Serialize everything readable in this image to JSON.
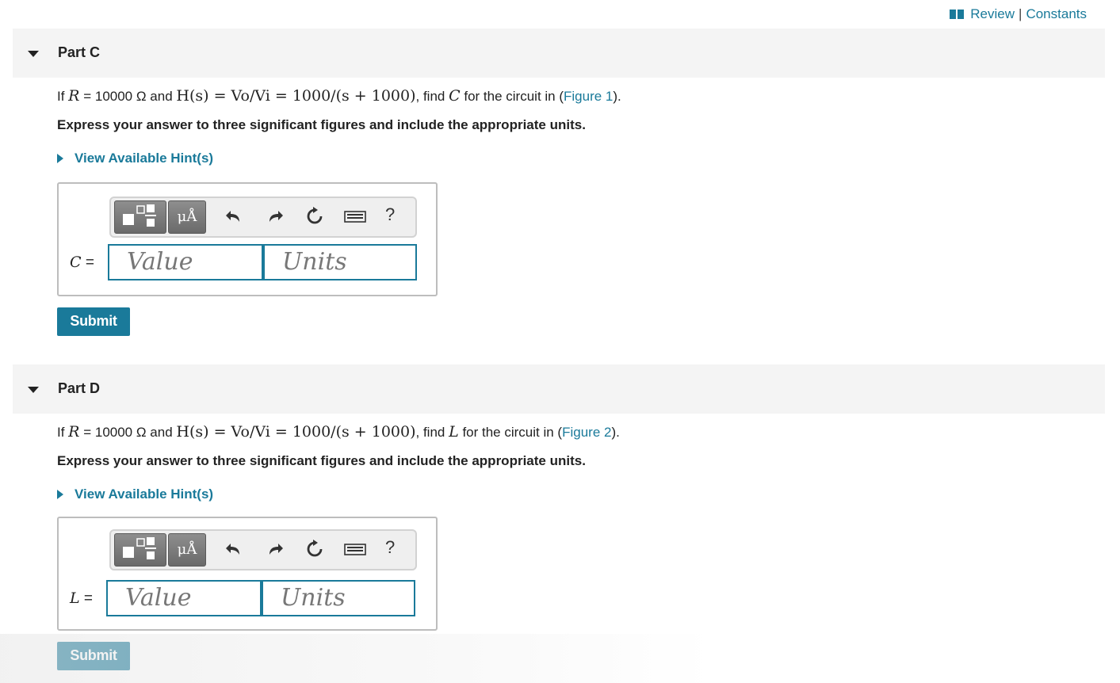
{
  "header": {
    "review_label": "Review",
    "separator": "|",
    "constants_label": "Constants"
  },
  "parts": [
    {
      "title": "Part C",
      "q_if": "If ",
      "q_R_sym": "R",
      "q_R_val": " = 10000 Ω",
      "q_and": " and ",
      "q_H": "H(s) = Vo/Vi = 1000/(s + 1000)",
      "q_find": ", find ",
      "q_var": "C",
      "q_for": " for the circuit in (",
      "q_fig": "Figure 1",
      "q_close": ").",
      "instruction": "Express your answer to three significant figures and include the appropriate units.",
      "hint": "View Available Hint(s)",
      "var_label": "C",
      "eq": " =",
      "units_button": "μÅ",
      "help": "?",
      "value_placeholder": "Value",
      "units_placeholder": "Units",
      "submit": "Submit"
    },
    {
      "title": "Part D",
      "q_if": "If ",
      "q_R_sym": "R",
      "q_R_val": " = 10000 Ω",
      "q_and": " and ",
      "q_H": "H(s) = Vo/Vi = 1000/(s + 1000)",
      "q_find": ", find ",
      "q_var": "L",
      "q_for": " for the circuit in (",
      "q_fig": "Figure 2",
      "q_close": ").",
      "instruction": "Express your answer to three significant figures and include the appropriate units.",
      "hint": "View Available Hint(s)",
      "var_label": "L",
      "eq": " =",
      "units_button": "μÅ",
      "help": "?",
      "value_placeholder": "Value",
      "units_placeholder": "Units",
      "submit": "Submit"
    }
  ],
  "colors": {
    "accent": "#1a7a9a",
    "header_bg": "#f4f4f4",
    "toolbar_bg": "#efefef"
  }
}
